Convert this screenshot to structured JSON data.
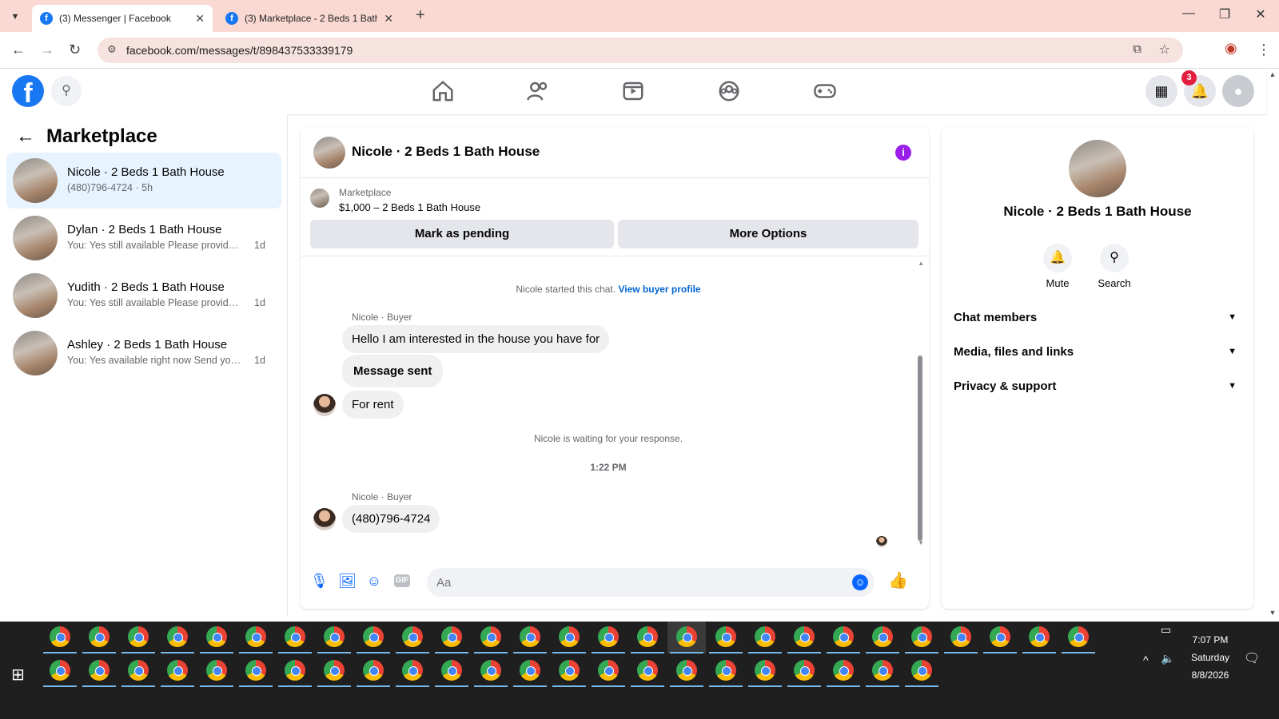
{
  "browser": {
    "tabs": [
      {
        "title": "(3) Messenger | Facebook",
        "active": true
      },
      {
        "title": "(3) Marketplace - 2 Beds 1 Bath",
        "active": false
      }
    ],
    "url": "facebook.com/messages/t/898437533339179"
  },
  "fb_header": {
    "logo": "f",
    "notification_count": "3",
    "nav_icons": [
      "home-icon",
      "friends-icon",
      "video-icon",
      "groups-icon",
      "gaming-icon"
    ]
  },
  "sidebar": {
    "title": "Marketplace",
    "conversations": [
      {
        "name": "Nicole · 2 Beds 1 Bath House",
        "preview": "(480)796-4724",
        "time": "5h",
        "selected": true
      },
      {
        "name": "Dylan · 2 Beds 1 Bath House",
        "preview": "You: Yes still available Please provide ...",
        "time": "1d",
        "selected": false
      },
      {
        "name": "Yudith · 2 Beds 1 Bath House",
        "preview": "You: Yes still available Please provide ...",
        "time": "1d",
        "selected": false
      },
      {
        "name": "Ashley · 2 Beds 1 Bath House",
        "preview": "You: Yes available right now Send you...",
        "time": "1d",
        "selected": false
      }
    ]
  },
  "chat": {
    "title": "Nicole · 2 Beds 1 Bath House",
    "listing": {
      "label": "Marketplace",
      "price_title": "$1,000 – 2 Beds 1 Bath House"
    },
    "buttons": {
      "pending": "Mark as pending",
      "more": "More Options"
    },
    "started": {
      "text": "Nicole started this chat.",
      "link": "View buyer profile"
    },
    "sender1": "Nicole · Buyer",
    "msg1": "Hello I am interested in the house you have for",
    "msg2": "Message sent",
    "msg3": "For rent",
    "waiting": "Nicole is waiting for your response.",
    "time": "1:22 PM",
    "sender2": "Nicole · Buyer",
    "msg4": "(480)796-4724",
    "composer_placeholder": "Aa"
  },
  "info_panel": {
    "name": "Nicole · 2 Beds 1 Bath House",
    "mute": "Mute",
    "search": "Search",
    "sections": [
      "Chat members",
      "Media, files and links",
      "Privacy & support"
    ]
  },
  "taskbar": {
    "time": "7:07 PM",
    "day": "Saturday",
    "date": "8/8/2026"
  }
}
